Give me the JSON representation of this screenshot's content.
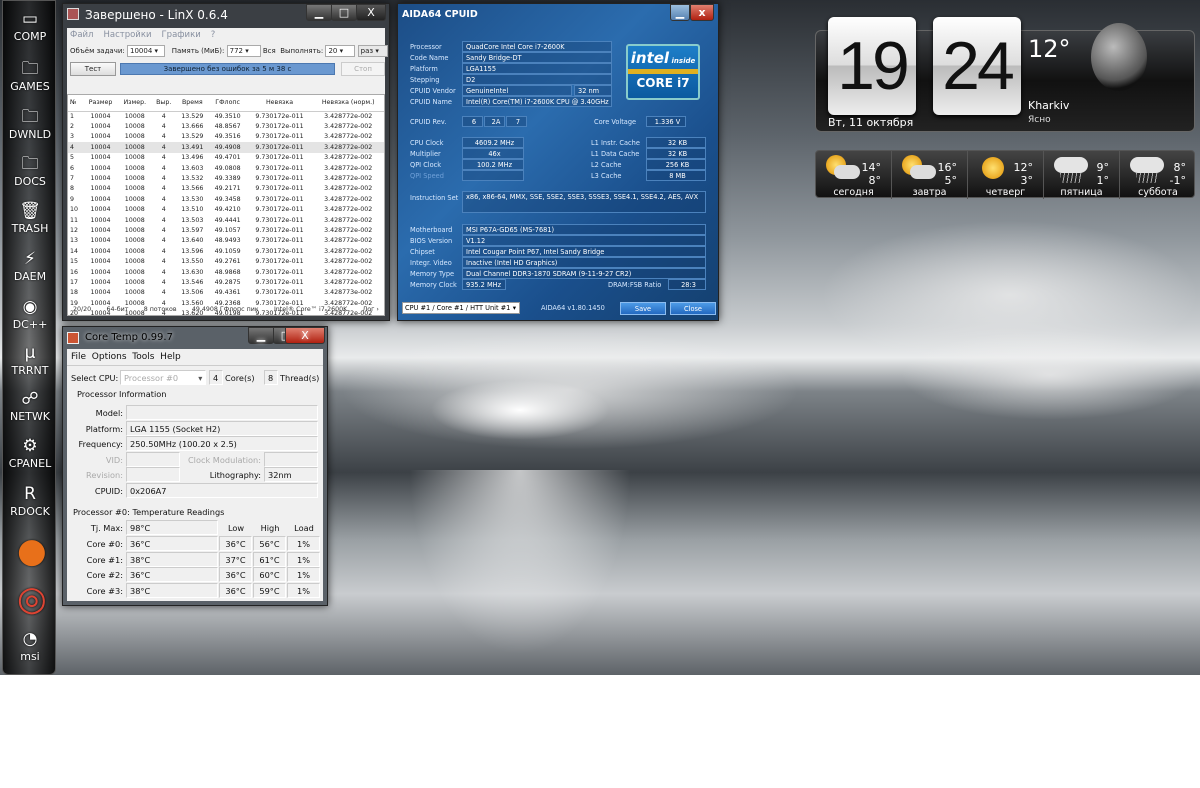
{
  "dock": [
    {
      "label": "COMP",
      "icon": "monitor-icon"
    },
    {
      "label": "GAMES",
      "icon": "folder-icon"
    },
    {
      "label": "DWNLD",
      "icon": "folder-icon"
    },
    {
      "label": "DOCS",
      "icon": "folder-icon"
    },
    {
      "label": "TRASH",
      "icon": "trash-icon"
    },
    {
      "label": "DAEM",
      "icon": "daemon-tools-icon"
    },
    {
      "label": "DC++",
      "icon": "dcpp-icon"
    },
    {
      "label": "TRRNT",
      "icon": "utorrent-icon"
    },
    {
      "label": "NETWK",
      "icon": "network-icon"
    },
    {
      "label": "CPANEL",
      "icon": "gears-icon"
    },
    {
      "label": "RDOCK",
      "icon": "rocketdock-icon"
    },
    {
      "label": "",
      "icon": "firefox-icon"
    },
    {
      "label": "",
      "icon": "chrome-icon"
    },
    {
      "label": "msi",
      "icon": "msi-afterburner-icon"
    }
  ],
  "linx": {
    "title": "Завершено - LinX 0.6.4",
    "menu": [
      "Файл",
      "Настройки",
      "Графики",
      "?"
    ],
    "task_label": "Объём задачи:",
    "task_value": "10004",
    "mem_label": "Память (МиБ):",
    "mem_value": "772",
    "all_label": "Вся",
    "run_label": "Выполнять:",
    "run_value": "20",
    "run_unit": "раз",
    "test_button": "Тест",
    "status": "Завершено без ошибок за 5 м 38 с",
    "stop_button": "Стоп",
    "progress": 100,
    "columns": [
      "№",
      "Размер",
      "Измер.",
      "Выр.",
      "Время",
      "ГФлопс",
      "Невязка",
      "Невязка (норм.)"
    ],
    "rows": [
      [
        "1",
        "10004",
        "10008",
        "4",
        "13.529",
        "49.3510",
        "9.730172e-011",
        "3.428772e-002"
      ],
      [
        "2",
        "10004",
        "10008",
        "4",
        "13.666",
        "48.8567",
        "9.730172e-011",
        "3.428772e-002"
      ],
      [
        "3",
        "10004",
        "10008",
        "4",
        "13.529",
        "49.3516",
        "9.730172e-011",
        "3.428772e-002"
      ],
      [
        "4",
        "10004",
        "10008",
        "4",
        "13.491",
        "49.4908",
        "9.730172e-011",
        "3.428772e-002"
      ],
      [
        "5",
        "10004",
        "10008",
        "4",
        "13.496",
        "49.4701",
        "9.730172e-011",
        "3.428772e-002"
      ],
      [
        "6",
        "10004",
        "10008",
        "4",
        "13.603",
        "49.0808",
        "9.730172e-011",
        "3.428772e-002"
      ],
      [
        "7",
        "10004",
        "10008",
        "4",
        "13.532",
        "49.3389",
        "9.730172e-011",
        "3.428772e-002"
      ],
      [
        "8",
        "10004",
        "10008",
        "4",
        "13.566",
        "49.2171",
        "9.730172e-011",
        "3.428772e-002"
      ],
      [
        "9",
        "10004",
        "10008",
        "4",
        "13.530",
        "49.3458",
        "9.730172e-011",
        "3.428772e-002"
      ],
      [
        "10",
        "10004",
        "10008",
        "4",
        "13.510",
        "49.4210",
        "9.730172e-011",
        "3.428772e-002"
      ],
      [
        "11",
        "10004",
        "10008",
        "4",
        "13.503",
        "49.4441",
        "9.730172e-011",
        "3.428772e-002"
      ],
      [
        "12",
        "10004",
        "10008",
        "4",
        "13.597",
        "49.1057",
        "9.730172e-011",
        "3.428772e-002"
      ],
      [
        "13",
        "10004",
        "10008",
        "4",
        "13.640",
        "48.9493",
        "9.730172e-011",
        "3.428772e-002"
      ],
      [
        "14",
        "10004",
        "10008",
        "4",
        "13.596",
        "49.1059",
        "9.730172e-011",
        "3.428772e-002"
      ],
      [
        "15",
        "10004",
        "10008",
        "4",
        "13.550",
        "49.2761",
        "9.730172e-011",
        "3.428772e-002"
      ],
      [
        "16",
        "10004",
        "10008",
        "4",
        "13.630",
        "48.9868",
        "9.730172e-011",
        "3.428772e-002"
      ],
      [
        "17",
        "10004",
        "10008",
        "4",
        "13.546",
        "49.2875",
        "9.730172e-011",
        "3.428772e-002"
      ],
      [
        "18",
        "10004",
        "10008",
        "4",
        "13.506",
        "49.4361",
        "9.730172e-011",
        "3.428773e-002"
      ],
      [
        "19",
        "10004",
        "10008",
        "4",
        "13.560",
        "49.2368",
        "9.730172e-011",
        "3.428772e-002"
      ],
      [
        "20",
        "10004",
        "10008",
        "4",
        "13.620",
        "49.0198",
        "9.730172e-011",
        "3.428772e-002"
      ]
    ],
    "statusbar": [
      "20/20",
      "64-бит",
      "8 потоков",
      "49.4908 ГФлопс пик",
      "Intel® Core™ i7-2600K",
      "Лог ›"
    ]
  },
  "aida": {
    "title": "AIDA64 CPUID",
    "top": [
      [
        "Processor",
        "QuadCore Intel Core i7-2600K"
      ],
      [
        "Code Name",
        "Sandy Bridge-DT"
      ],
      [
        "Platform",
        "LGA1155"
      ],
      [
        "Stepping",
        "D2"
      ],
      [
        "CPUID Vendor",
        "GenuineIntel"
      ],
      [
        "CPUID Name",
        "Intel(R) Core(TM) i7-2600K CPU @ 3.40GHz"
      ]
    ],
    "process": "32 nm",
    "logo": "intel inside CORE i7",
    "rev_label": "CPUID Rev.",
    "rev": [
      "6",
      "2A",
      "7"
    ],
    "voltage_label": "Core Voltage",
    "voltage": "1.336 V",
    "left": [
      [
        "CPU Clock",
        "4609.2 MHz"
      ],
      [
        "Multiplier",
        "46x"
      ],
      [
        "QPI Clock",
        "100.2 MHz"
      ],
      [
        "QPI Speed",
        ""
      ]
    ],
    "right": [
      [
        "L1 Instr. Cache",
        "32 KB"
      ],
      [
        "L1 Data Cache",
        "32 KB"
      ],
      [
        "L2 Cache",
        "256 KB"
      ],
      [
        "L3 Cache",
        "8 MB"
      ]
    ],
    "iset_label": "Instruction Set",
    "iset": "x86, x86-64, MMX, SSE, SSE2, SSE3, SSSE3, SSE4.1, SSE4.2, AES, AVX",
    "board": [
      [
        "Motherboard",
        "MSI P67A-GD65 (MS-7681)"
      ],
      [
        "BIOS Version",
        "V1.12"
      ],
      [
        "Chipset",
        "Intel Cougar Point P67, Intel Sandy Bridge"
      ],
      [
        "Integr. Video",
        "Inactive  (Intel HD Graphics)"
      ],
      [
        "Memory Type",
        "Dual Channel DDR3-1870 SDRAM  (9-11-9-27 CR2)"
      ],
      [
        "Memory Clock",
        "935.2 MHz"
      ]
    ],
    "ratio_label": "DRAM:FSB Ratio",
    "ratio": "28:3",
    "cpu_select": "CPU #1 / Core #1 / HTT Unit #1",
    "version": "AIDA64 v1.80.1450",
    "save": "Save",
    "close": "Close"
  },
  "coretemp": {
    "title": "Core Temp 0.99.7",
    "menu": [
      "File",
      "Options",
      "Tools",
      "Help"
    ],
    "select_label": "Select CPU:",
    "select_value": "Processor #0",
    "cores": "4",
    "cores_label": "Core(s)",
    "threads": "8",
    "threads_label": "Thread(s)",
    "info_header": "Processor Information",
    "model_label": "Model:",
    "model": "",
    "platform_label": "Platform:",
    "platform": "LGA 1155 (Socket H2)",
    "freq_label": "Frequency:",
    "freq": "250.50MHz (100.20 x 2.5)",
    "vid_label": "VID:",
    "clockmod_label": "Clock Modulation:",
    "revision_label": "Revision:",
    "litho_label": "Lithography:",
    "litho": "32nm",
    "cpuid_label": "CPUID:",
    "cpuid": "0x206A7",
    "temp_header": "Processor #0: Temperature Readings",
    "tj_label": "Tj. Max:",
    "tj": "98°C",
    "col_low": "Low",
    "col_high": "High",
    "col_load": "Load",
    "cores_rows": [
      [
        "Core #0:",
        "36°C",
        "36°C",
        "56°C",
        "1%"
      ],
      [
        "Core #1:",
        "38°C",
        "37°C",
        "61°C",
        "1%"
      ],
      [
        "Core #2:",
        "36°C",
        "36°C",
        "60°C",
        "1%"
      ],
      [
        "Core #3:",
        "38°C",
        "36°C",
        "59°C",
        "1%"
      ]
    ]
  },
  "clock": {
    "hour": "19",
    "minute": "24",
    "date": "Вт, 11 октября",
    "temp": "12°",
    "city": "Kharkiv",
    "cond": "Ясно"
  },
  "forecast": [
    {
      "day": "сегодня",
      "hi": "14°",
      "lo": "8°",
      "icon": "partly-cloudy-icon"
    },
    {
      "day": "завтра",
      "hi": "16°",
      "lo": "5°",
      "icon": "partly-cloudy-icon"
    },
    {
      "day": "четверг",
      "hi": "12°",
      "lo": "3°",
      "icon": "sun-icon"
    },
    {
      "day": "пятница",
      "hi": "9°",
      "lo": "1°",
      "icon": "rain-icon"
    },
    {
      "day": "суббота",
      "hi": "8°",
      "lo": "-1°",
      "icon": "rain-icon"
    }
  ]
}
